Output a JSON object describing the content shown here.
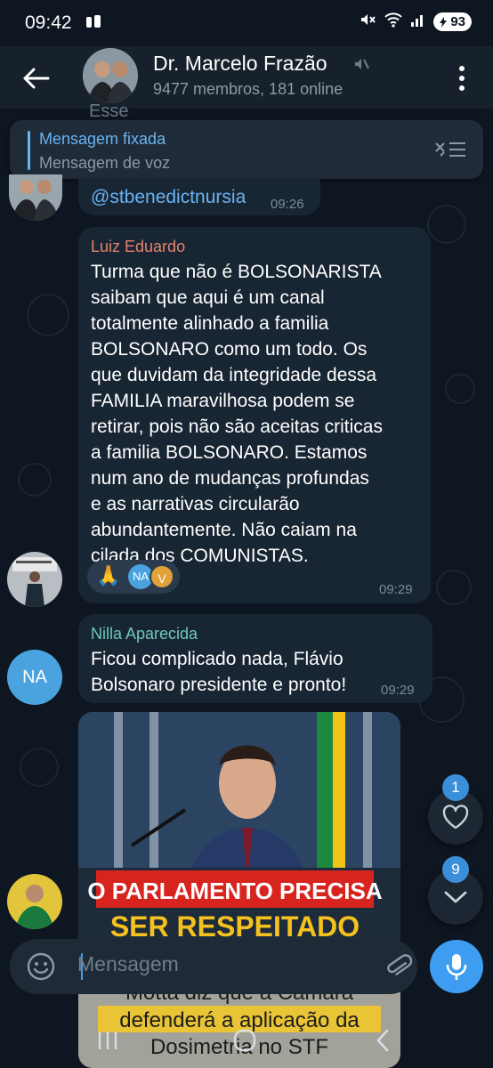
{
  "status_bar": {
    "time": "09:42",
    "battery": "93"
  },
  "header": {
    "title": "Dr. Marcelo Frazão",
    "subtitle": "9477 membros, 181 online"
  },
  "pinned": {
    "title": "Mensagem fixada",
    "text": "Mensagem de voz"
  },
  "messages": [
    {
      "partial_text": "Esse",
      "text": "@stbenedictnursia",
      "time": "09:26"
    },
    {
      "sender": "Luiz Eduardo",
      "sender_color": "#e5836b",
      "lines": [
        "Turma que não é BOLSONARISTA",
        "saibam que aqui é um canal",
        "totalmente alinhado a familia",
        "BOLSONARO como um todo. Os",
        "que duvidam da integridade dessa",
        "FAMILIA maravilhosa podem se",
        "retirar, pois não são aceitas criticas",
        "a familia BOLSONARO. Estamos",
        "num ano de mudanças profundas",
        "e as narrativas circularão",
        "abundantemente. Não caiam na",
        "cilada dos COMUNISTAS."
      ],
      "reaction_emoji": "🙏",
      "reactor_initials_1": "NA",
      "reactor_initials_2": "V",
      "time": "09:29"
    },
    {
      "sender": "Nilla Aparecida",
      "sender_color": "#6fc9b7",
      "avatar_initials": "NA",
      "lines": [
        "Ficou complicado nada, Flávio",
        "Bolsonaro presidente e pronto!"
      ],
      "time": "09:29"
    }
  ],
  "post_image": {
    "headline_1": "O PARLAMENTO PRECISA",
    "headline_2": "SER RESPEITADO",
    "caption_1": "Motta diz que a Câmara",
    "caption_2": "defenderá a aplicação da",
    "caption_3": "Dosimetria no STF"
  },
  "fabs": {
    "reactions_count": "1",
    "unread_count": "9"
  },
  "composer": {
    "placeholder": "Mensagem"
  },
  "colors": {
    "background": "#0e1621",
    "bubble": "#182533",
    "accent": "#3e9df0"
  }
}
